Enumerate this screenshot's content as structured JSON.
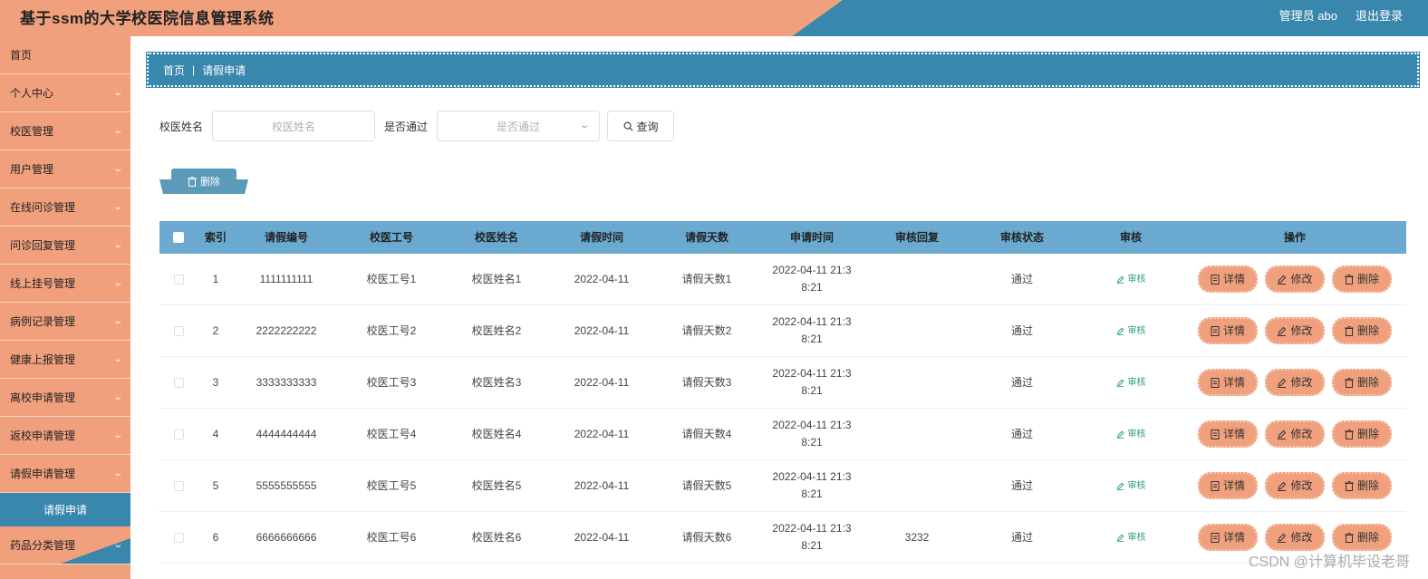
{
  "app": {
    "title": "基于ssm的大学校医院信息管理系统"
  },
  "header": {
    "user": "管理员 abo",
    "logout": "退出登录"
  },
  "sidebar": {
    "items": [
      {
        "label": "首页",
        "has_children": false
      },
      {
        "label": "个人中心",
        "has_children": true
      },
      {
        "label": "校医管理",
        "has_children": true
      },
      {
        "label": "用户管理",
        "has_children": true
      },
      {
        "label": "在线问诊管理",
        "has_children": true
      },
      {
        "label": "问诊回复管理",
        "has_children": true
      },
      {
        "label": "线上挂号管理",
        "has_children": true
      },
      {
        "label": "病例记录管理",
        "has_children": true
      },
      {
        "label": "健康上报管理",
        "has_children": true
      },
      {
        "label": "离校申请管理",
        "has_children": true
      },
      {
        "label": "返校申请管理",
        "has_children": true
      },
      {
        "label": "请假申请管理",
        "has_children": true
      }
    ],
    "active_sub": "请假申请",
    "last_item": "药品分类管理"
  },
  "breadcrumb": {
    "home": "首页",
    "separator": "|",
    "current": "请假申请"
  },
  "search": {
    "name_label": "校医姓名",
    "name_placeholder": "校医姓名",
    "pass_label": "是否通过",
    "pass_placeholder": "是否通过",
    "query_label": "查询"
  },
  "delete_button": "删除",
  "table": {
    "headers": [
      "索引",
      "请假编号",
      "校医工号",
      "校医姓名",
      "请假时间",
      "请假天数",
      "申请时间",
      "审核回复",
      "审核状态",
      "审核",
      "操作"
    ],
    "rows": [
      {
        "idx": "1",
        "no": "1111111111",
        "gh": "校医工号1",
        "name": "校医姓名1",
        "date": "2022-04-11",
        "days": "请假天数1",
        "apply1": "2022-04-11 21:3",
        "apply2": "8:21",
        "reply": "",
        "status": "通过"
      },
      {
        "idx": "2",
        "no": "2222222222",
        "gh": "校医工号2",
        "name": "校医姓名2",
        "date": "2022-04-11",
        "days": "请假天数2",
        "apply1": "2022-04-11 21:3",
        "apply2": "8:21",
        "reply": "",
        "status": "通过"
      },
      {
        "idx": "3",
        "no": "3333333333",
        "gh": "校医工号3",
        "name": "校医姓名3",
        "date": "2022-04-11",
        "days": "请假天数3",
        "apply1": "2022-04-11 21:3",
        "apply2": "8:21",
        "reply": "",
        "status": "通过"
      },
      {
        "idx": "4",
        "no": "4444444444",
        "gh": "校医工号4",
        "name": "校医姓名4",
        "date": "2022-04-11",
        "days": "请假天数4",
        "apply1": "2022-04-11 21:3",
        "apply2": "8:21",
        "reply": "",
        "status": "通过"
      },
      {
        "idx": "5",
        "no": "5555555555",
        "gh": "校医工号5",
        "name": "校医姓名5",
        "date": "2022-04-11",
        "days": "请假天数5",
        "apply1": "2022-04-11 21:3",
        "apply2": "8:21",
        "reply": "",
        "status": "通过"
      },
      {
        "idx": "6",
        "no": "6666666666",
        "gh": "校医工号6",
        "name": "校医姓名6",
        "date": "2022-04-11",
        "days": "请假天数6",
        "apply1": "2022-04-11 21:3",
        "apply2": "8:21",
        "reply": "3232",
        "status": "通过"
      }
    ],
    "audit_label": "审核",
    "ops": {
      "detail": "详情",
      "edit": "修改",
      "delete": "删除"
    }
  },
  "watermark": "CSDN @计算机毕设老哥",
  "colors": {
    "orange": "#f0a07c",
    "blue": "#3a87ad",
    "audit_green": "#2f9e76"
  }
}
